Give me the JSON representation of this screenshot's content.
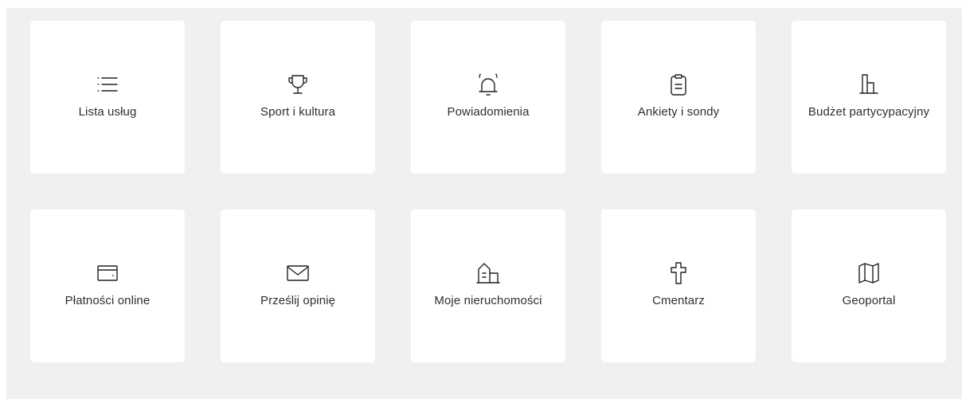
{
  "tiles": [
    {
      "label": "Lista usług",
      "icon": "list-icon"
    },
    {
      "label": "Sport i kultura",
      "icon": "trophy-icon"
    },
    {
      "label": "Powiadomienia",
      "icon": "alarm-bell-icon"
    },
    {
      "label": "Ankiety i sondy",
      "icon": "clipboard-icon"
    },
    {
      "label": "Budżet partycypacyjny",
      "icon": "buildings-chart-icon"
    },
    {
      "label": "Płatności online",
      "icon": "wallet-icon"
    },
    {
      "label": "Prześlij opinię",
      "icon": "envelope-icon"
    },
    {
      "label": "Moje nieruchomości",
      "icon": "house-building-icon"
    },
    {
      "label": "Cmentarz",
      "icon": "cross-icon"
    },
    {
      "label": "Geoportal",
      "icon": "map-icon"
    }
  ],
  "colors": {
    "panel_background": "#f0f1ef",
    "tile_background": "#ffffff",
    "text": "#2d2f33",
    "icon_stroke": "#1f2124"
  }
}
